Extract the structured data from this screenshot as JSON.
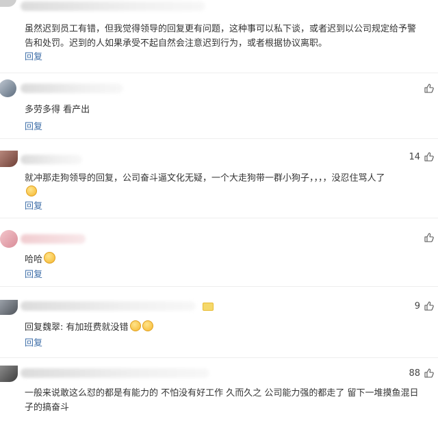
{
  "comments": [
    {
      "text": "虽然迟到员工有错，但我觉得领导的回复更有问题，这种事可以私下谈，或者迟到以公司规定给予警告和处罚。迟到的人如果承受不起自然会注意迟到行为，或者根据协议离职。",
      "likes": "",
      "reply_label": "回复",
      "avatar_color": "#c8c8c8"
    },
    {
      "text": "多劳多得 看产出",
      "likes": "",
      "reply_label": "回复",
      "avatar_color": "#7a8a99"
    },
    {
      "text": "就冲那走狗领导的回复，公司奋斗逼文化无疑，一个大走狗带一群小狗子，，，，没忍住骂人了",
      "likes": "14",
      "reply_label": "回复",
      "avatar_color": "#8a5a52"
    },
    {
      "text": "哈哈",
      "likes": "",
      "reply_label": "回复",
      "avatar_color": "#e8a0a8"
    },
    {
      "text": "回复魏翠: 有加班费就没错",
      "likes": "9",
      "reply_label": "回复",
      "avatar_color": "#6b6f76"
    },
    {
      "text": "一般来说敢这么怼的都是有能力的 不怕没有好工作 久而久之 公司能力强的都走了 留下一堆摸鱼混日子的搞奋斗",
      "likes": "88",
      "reply_label": "回复",
      "avatar_color": "#5a5a5a"
    }
  ]
}
